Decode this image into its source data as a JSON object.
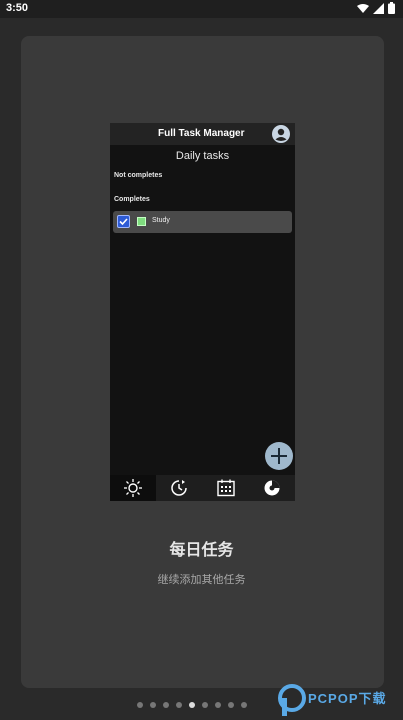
{
  "status_bar": {
    "time": "3:50",
    "icons": [
      "wifi-icon",
      "signal-icon",
      "battery-icon"
    ]
  },
  "app": {
    "title": "Full Task Manager",
    "screen_title": "Daily tasks",
    "sections": {
      "not_completes": "Not completes",
      "completes": "Completes"
    },
    "tasks": [
      {
        "name": "Study",
        "completed": true,
        "color": "#7fdc7f"
      }
    ],
    "bottom_nav": [
      {
        "icon": "sun-icon",
        "active": true
      },
      {
        "icon": "clock-icon",
        "active": false
      },
      {
        "icon": "calendar-icon",
        "active": false
      },
      {
        "icon": "pie-chart-icon",
        "active": false
      }
    ]
  },
  "onboarding": {
    "headline": "每日任务",
    "subtext": "继续添加其他任务",
    "page_count": 9,
    "active_page": 5
  },
  "colors": {
    "checkbox": "#2d5bd6",
    "fab": "#9fb8cc",
    "task_swatch": "#7fdc7f"
  }
}
